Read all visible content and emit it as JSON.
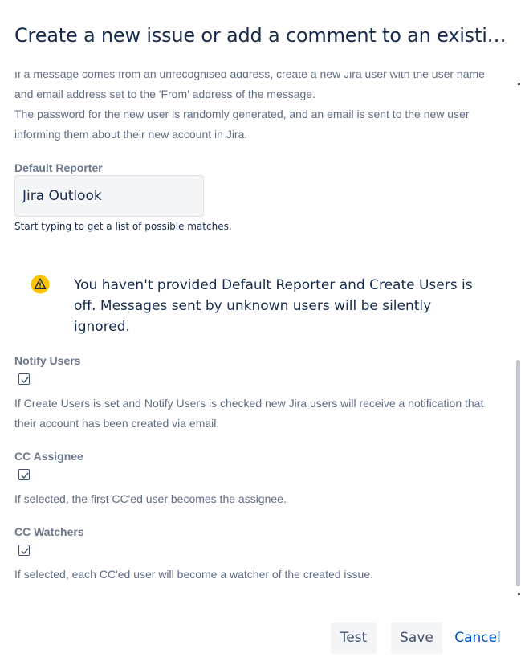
{
  "dialog": {
    "title": "Create a new issue or add a comment to an existing iss..."
  },
  "create_users": {
    "description_line1": "If a message comes from an unrecognised address, create a new Jira user with the user name and email address set to the 'From' address of the message.",
    "description_line2": "The password for the new user is randomly generated, and an email is sent to the new user informing them about their new account in Jira."
  },
  "default_reporter": {
    "label": "Default Reporter",
    "value": "Jira Outlook",
    "help": "Start typing to get a list of possible matches."
  },
  "warning": {
    "icon": "warning-icon",
    "text": "You haven't provided Default Reporter and Create Users is off. Messages sent by unknown users will be silently ignored.",
    "color": "#ffc400"
  },
  "notify_users": {
    "label": "Notify Users",
    "checked": true,
    "description": "If Create Users is set and Notify Users is checked new Jira users will receive a notification that their account has been created via email."
  },
  "cc_assignee": {
    "label": "CC Assignee",
    "checked": true,
    "description": "If selected, the first CC'ed user becomes the assignee."
  },
  "cc_watchers": {
    "label": "CC Watchers",
    "checked": true,
    "description": "If selected, each CC'ed user will become a watcher of the created issue."
  },
  "footer": {
    "test_label": "Test",
    "save_label": "Save",
    "cancel_label": "Cancel",
    "link_color": "#0052cc"
  }
}
